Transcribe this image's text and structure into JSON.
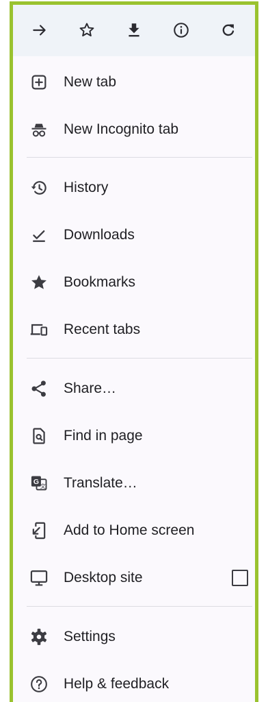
{
  "toolbar": {
    "buttons": [
      {
        "name": "forward",
        "icon": "arrow-right-icon"
      },
      {
        "name": "bookmark",
        "icon": "star-outline-icon"
      },
      {
        "name": "download",
        "icon": "download-icon"
      },
      {
        "name": "page-info",
        "icon": "info-icon"
      },
      {
        "name": "reload",
        "icon": "refresh-icon"
      }
    ]
  },
  "menu": {
    "items": [
      {
        "label": "New tab",
        "icon": "plus-box-icon"
      },
      {
        "label": "New Incognito tab",
        "icon": "incognito-icon"
      },
      {
        "label": "History",
        "icon": "history-icon"
      },
      {
        "label": "Downloads",
        "icon": "download-done-icon"
      },
      {
        "label": "Bookmarks",
        "icon": "star-filled-icon"
      },
      {
        "label": "Recent tabs",
        "icon": "devices-icon"
      },
      {
        "label": "Share…",
        "icon": "share-icon"
      },
      {
        "label": "Find in page",
        "icon": "find-in-page-icon"
      },
      {
        "label": "Translate…",
        "icon": "translate-icon"
      },
      {
        "label": "Add to Home screen",
        "icon": "add-to-home-icon"
      },
      {
        "label": "Desktop site",
        "icon": "desktop-icon",
        "checked": false
      },
      {
        "label": "Settings",
        "icon": "gear-icon"
      },
      {
        "label": "Help & feedback",
        "icon": "help-icon"
      }
    ]
  },
  "colors": {
    "frame_border": "#9ac22f",
    "menu_background": "#fbf9fd",
    "toolbar_background": "#eff3f8",
    "text": "#1f1f23",
    "icon": "#3c3c42"
  }
}
